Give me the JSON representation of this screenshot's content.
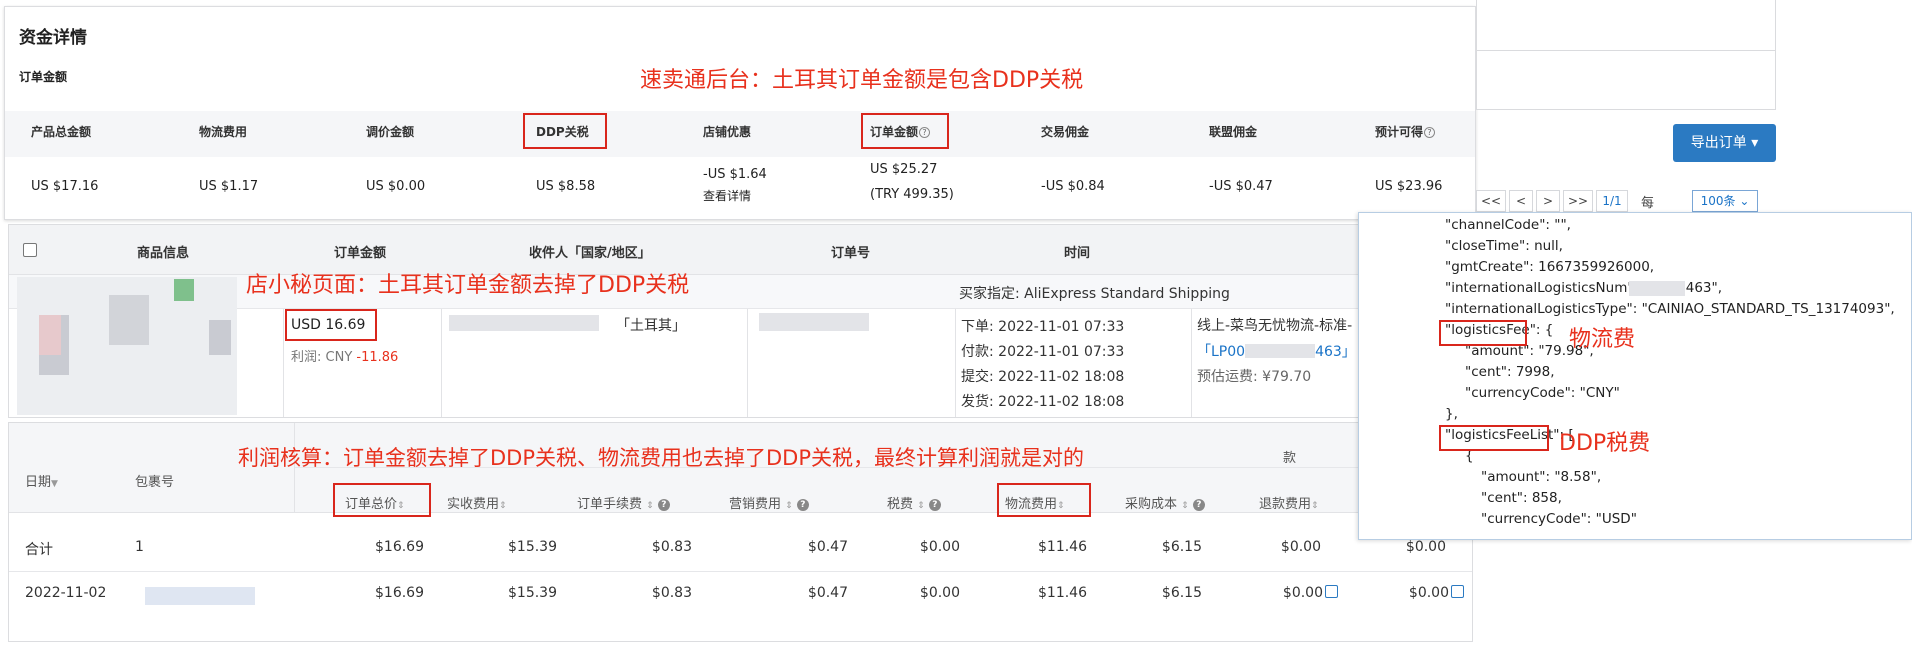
{
  "panel1": {
    "title": "资金详情",
    "subtitle": "订单金额",
    "annotation": "速卖通后台：土耳其订单金额是包含DDP关税",
    "headers": [
      "产品总金额",
      "物流费用",
      "调价金额",
      "DDP关税",
      "店铺优惠",
      "订单金额",
      "交易佣金",
      "联盟佣金",
      "预计可得"
    ],
    "values": [
      "US $17.16",
      "US $1.17",
      "US $0.00",
      "US $8.58",
      "-US $1.64",
      "US $25.27",
      "-US $0.84",
      "-US $0.47",
      "US $23.96"
    ],
    "discount_link": "查看详情",
    "order_amount_try": "(TRY 499.35)"
  },
  "top_right": {
    "export_button": "导出订单 ▾",
    "pager": {
      "first": "<<",
      "prev": "<",
      "next": ">",
      "last": ">>",
      "page": "1/1",
      "per_page_label": "每页",
      "per_page_value": "100条"
    }
  },
  "panel2": {
    "annotation": "店小秘页面：土耳其订单金额去掉了DDP关税",
    "headers": [
      "商品信息",
      "订单金额",
      "收件人「国家/地区」",
      "订单号",
      "时间"
    ],
    "buyer_shipping": "买家指定:  AliExpress Standard Shipping",
    "order_amount": "USD 16.69",
    "profit_label": "利润: CNY ",
    "profit_value": "-11.86",
    "country": "「土耳其」",
    "times": [
      "下单:  2022-11-01 07:33",
      "付款:  2022-11-01 07:33",
      "提交:  2022-11-02 18:08",
      "发货:  2022-11-02 18:08"
    ],
    "logistics_line": "线上-菜鸟无忧物流-标准-",
    "tracking_prefix": "「LP00",
    "tracking_suffix": "463」",
    "estimated_freight": "预估运费:  ¥79.70"
  },
  "panel3": {
    "annotation": "利润核算：订单金额去掉了DDP关税、物流费用也去掉了DDP关税，最终计算利润就是对的",
    "col_date": "日期",
    "col_package": "包裹号",
    "top_header_partial": "款",
    "headers": [
      "订单总价",
      "实收费用",
      "订单手续费",
      "营销费用",
      "税费",
      "物流费用",
      "采购成本",
      "退款费用"
    ],
    "rows": [
      {
        "date": "合计",
        "package": "1",
        "values": [
          "$16.69",
          "$15.39",
          "$0.83",
          "$0.47",
          "$0.00",
          "$11.46",
          "$6.15",
          "$0.00",
          "$0.00"
        ]
      },
      {
        "date": "2022-11-02",
        "package": "",
        "values": [
          "$16.69",
          "$15.39",
          "$0.83",
          "$0.47",
          "$0.00",
          "$11.46",
          "$6.15",
          "$0.00",
          "$0.00"
        ]
      }
    ]
  },
  "panel4": {
    "lines": [
      "\"channelCode\": \"\",",
      "\"closeTime\": null,",
      "\"gmtCreate\": 1667359926000,",
      "\"internationalLogisticsNum\": \"LP00               463\",",
      "\"internationalLogisticsType\": \"CAINIAO_STANDARD_TS_13174093\",",
      "\"logisticsFee\": {",
      "\"amount\": \"79.98\",",
      "\"cent\": 7998,",
      "\"currencyCode\": \"CNY\"",
      "},",
      "\"logisticsFeeList\": [",
      "{",
      "\"amount\": \"8.58\",",
      "\"cent\": 858,",
      "\"currencyCode\": \"USD\""
    ],
    "annotation_logistics": "物流费",
    "annotation_ddp": "DDP税费"
  }
}
